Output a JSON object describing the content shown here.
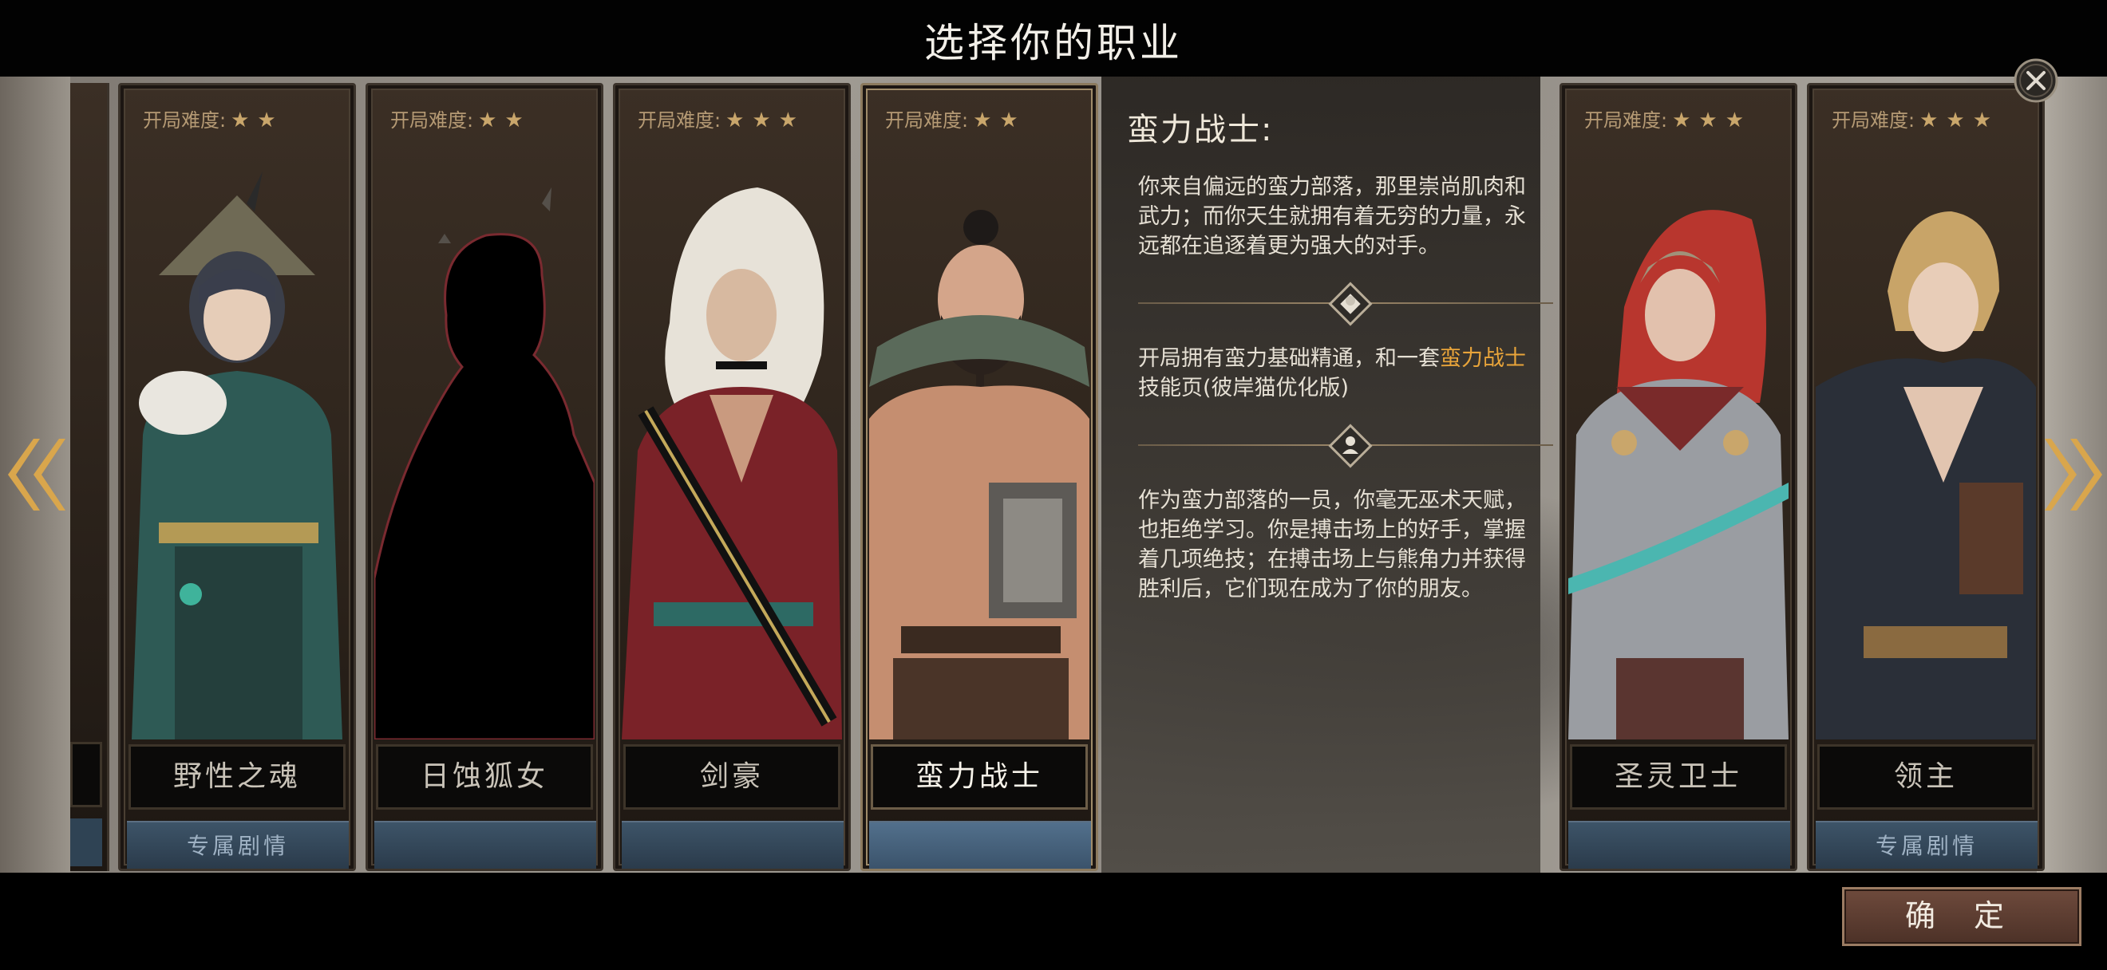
{
  "header": {
    "title": "选择你的职业"
  },
  "difficulty_label": "开局难度:",
  "classes": [
    {
      "name": "野性之魂",
      "difficulty_stars": 2,
      "story_label": "专属剧情",
      "selected": false,
      "locked": false
    },
    {
      "name": "日蚀狐女",
      "difficulty_stars": 2,
      "story_label": "",
      "selected": false,
      "locked": true
    },
    {
      "name": "剑豪",
      "difficulty_stars": 3,
      "story_label": "",
      "selected": false,
      "locked": false
    },
    {
      "name": "蛮力战士",
      "difficulty_stars": 2,
      "story_label": "",
      "selected": true,
      "locked": false
    },
    {
      "name": "圣灵卫士",
      "difficulty_stars": 3,
      "story_label": "",
      "selected": false,
      "locked": false
    },
    {
      "name": "领主",
      "difficulty_stars": 3,
      "story_label": "专属剧情",
      "selected": false,
      "locked": false
    }
  ],
  "detail": {
    "title": "蛮力战士:",
    "intro": "你来自偏远的蛮力部落，那里崇尚肌肉和武力；而你天生就拥有着无穷的力量，永远都在追逐着更为强大的对手。",
    "start_prefix": "开局拥有蛮力基础精通，和一套",
    "start_highlight": "蛮力战士",
    "start_suffix": "技能页(彼岸猫优化版)",
    "lore": "作为蛮力部落的一员，你毫无巫术天赋，也拒绝学习。你是搏击场上的好手，掌握着几项绝技；在搏击场上与熊角力并获得胜利后，它们现在成为了你的朋友。"
  },
  "footer": {
    "confirm_label": "确 定"
  },
  "icons": {
    "close": "close-icon",
    "prev": "double-chevron-left-icon",
    "next": "double-chevron-right-icon",
    "divider1": "fist-icon",
    "divider2": "bust-icon",
    "star": "star-icon"
  },
  "colors": {
    "highlight": "#e8a43a",
    "star": "#c9a66b",
    "confirm_bg": "#5c3d31"
  }
}
